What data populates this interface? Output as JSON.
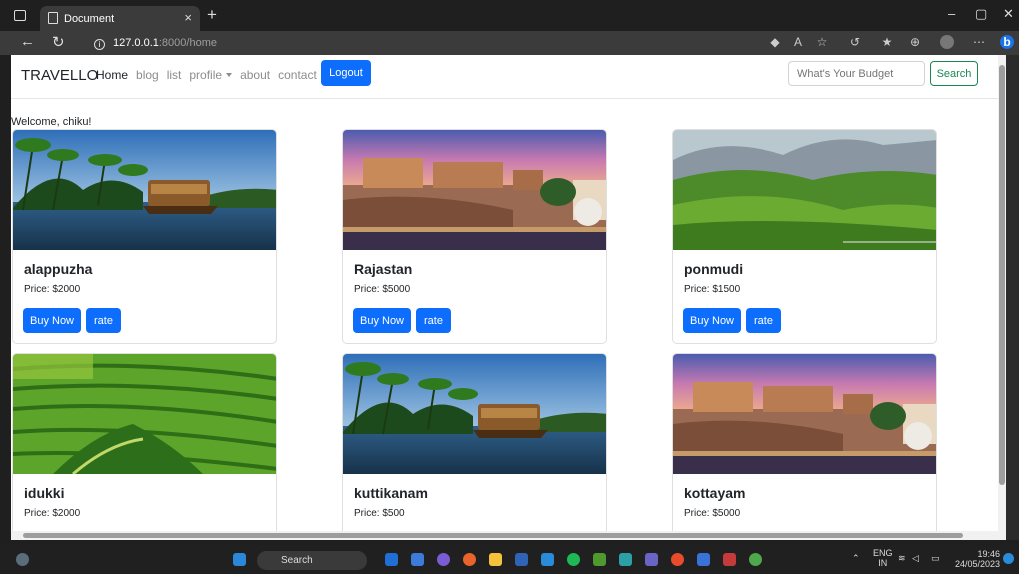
{
  "browser": {
    "tab_title": "Document",
    "url_host": "127.0.0.1",
    "url_path": ":8000/home"
  },
  "navbar": {
    "brand": "TRAVELLO",
    "links": [
      "Home",
      "blog",
      "list",
      "profile",
      "about",
      "contact"
    ],
    "logout_label": "Logout",
    "search_placeholder": "What's Your Budget",
    "search_label": "Search"
  },
  "welcome": "Welcome, chiku!",
  "cards": [
    {
      "title": "alappuzha",
      "price": "Price: $2000",
      "image": "backwater-houseboat"
    },
    {
      "title": "Rajastan",
      "price": "Price: $5000",
      "image": "amber-fort"
    },
    {
      "title": "ponmudi",
      "price": "Price: $1500",
      "image": "green-hills"
    },
    {
      "title": "idukki",
      "price": "Price: $2000",
      "image": "tea-plantation"
    },
    {
      "title": "kuttikanam",
      "price": "Price: $500",
      "image": "backwater-houseboat"
    },
    {
      "title": "kottayam",
      "price": "Price: $5000",
      "image": "amber-fort"
    }
  ],
  "card_buttons": {
    "buy": "Buy Now",
    "rate": "rate"
  },
  "taskbar": {
    "search": "Search",
    "lang": "ENG",
    "region": "IN",
    "time": "19:46",
    "date": "24/05/2023"
  }
}
